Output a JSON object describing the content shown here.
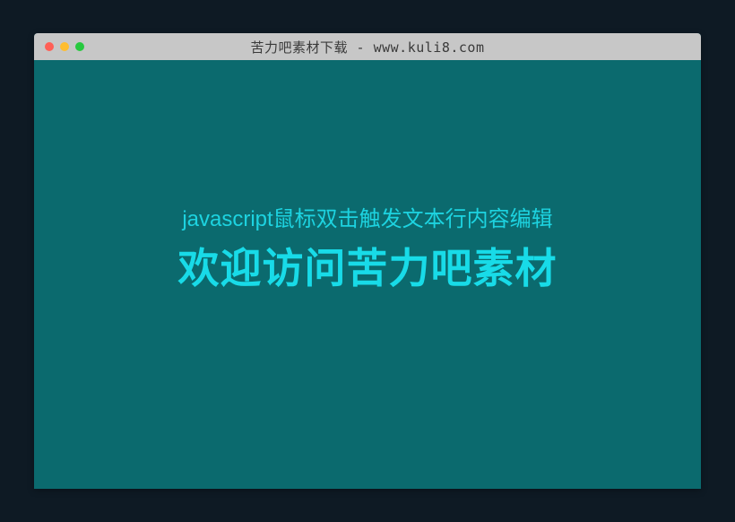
{
  "window": {
    "title": "苦力吧素材下载 - www.kuli8.com"
  },
  "content": {
    "subtitle": "javascript鼠标双击触发文本行内容编辑",
    "headline": "欢迎访问苦力吧素材"
  }
}
